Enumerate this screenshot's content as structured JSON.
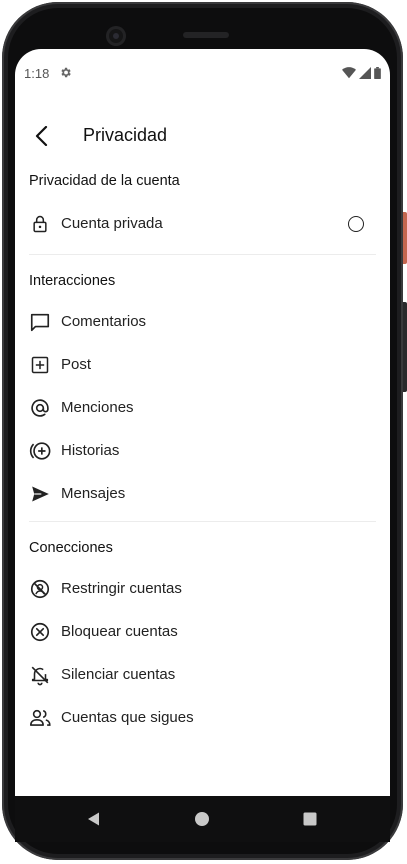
{
  "status_bar": {
    "time": "1:18",
    "icons": [
      "gear-icon",
      "wifi-icon",
      "signal-icon",
      "battery-icon"
    ]
  },
  "app_bar": {
    "title": "Privacidad",
    "back_icon": "back-arrow-icon"
  },
  "sections": {
    "account": {
      "title": "Privacidad de la cuenta",
      "items": [
        {
          "label": "Cuenta privada",
          "icon": "lock-icon",
          "toggle": "radio",
          "checked": false
        }
      ]
    },
    "interactions": {
      "title": "Interacciones",
      "items": [
        {
          "label": "Comentarios",
          "icon": "comment-icon"
        },
        {
          "label": "Post",
          "icon": "add-box-icon"
        },
        {
          "label": "Menciones",
          "icon": "at-sign-icon"
        },
        {
          "label": "Historias",
          "icon": "add-story-icon"
        },
        {
          "label": "Mensajes",
          "icon": "send-icon"
        }
      ]
    },
    "connections": {
      "title": "Conecciones",
      "items": [
        {
          "label": "Restringir cuentas",
          "icon": "restrict-icon"
        },
        {
          "label": "Bloquear cuentas",
          "icon": "block-icon"
        },
        {
          "label": "Silenciar cuentas",
          "icon": "mute-bell-icon"
        },
        {
          "label": "Cuentas que sigues",
          "icon": "people-icon"
        }
      ]
    }
  },
  "nav_bar": {
    "buttons": [
      "nav-back-icon",
      "nav-home-icon",
      "nav-recents-icon"
    ]
  }
}
